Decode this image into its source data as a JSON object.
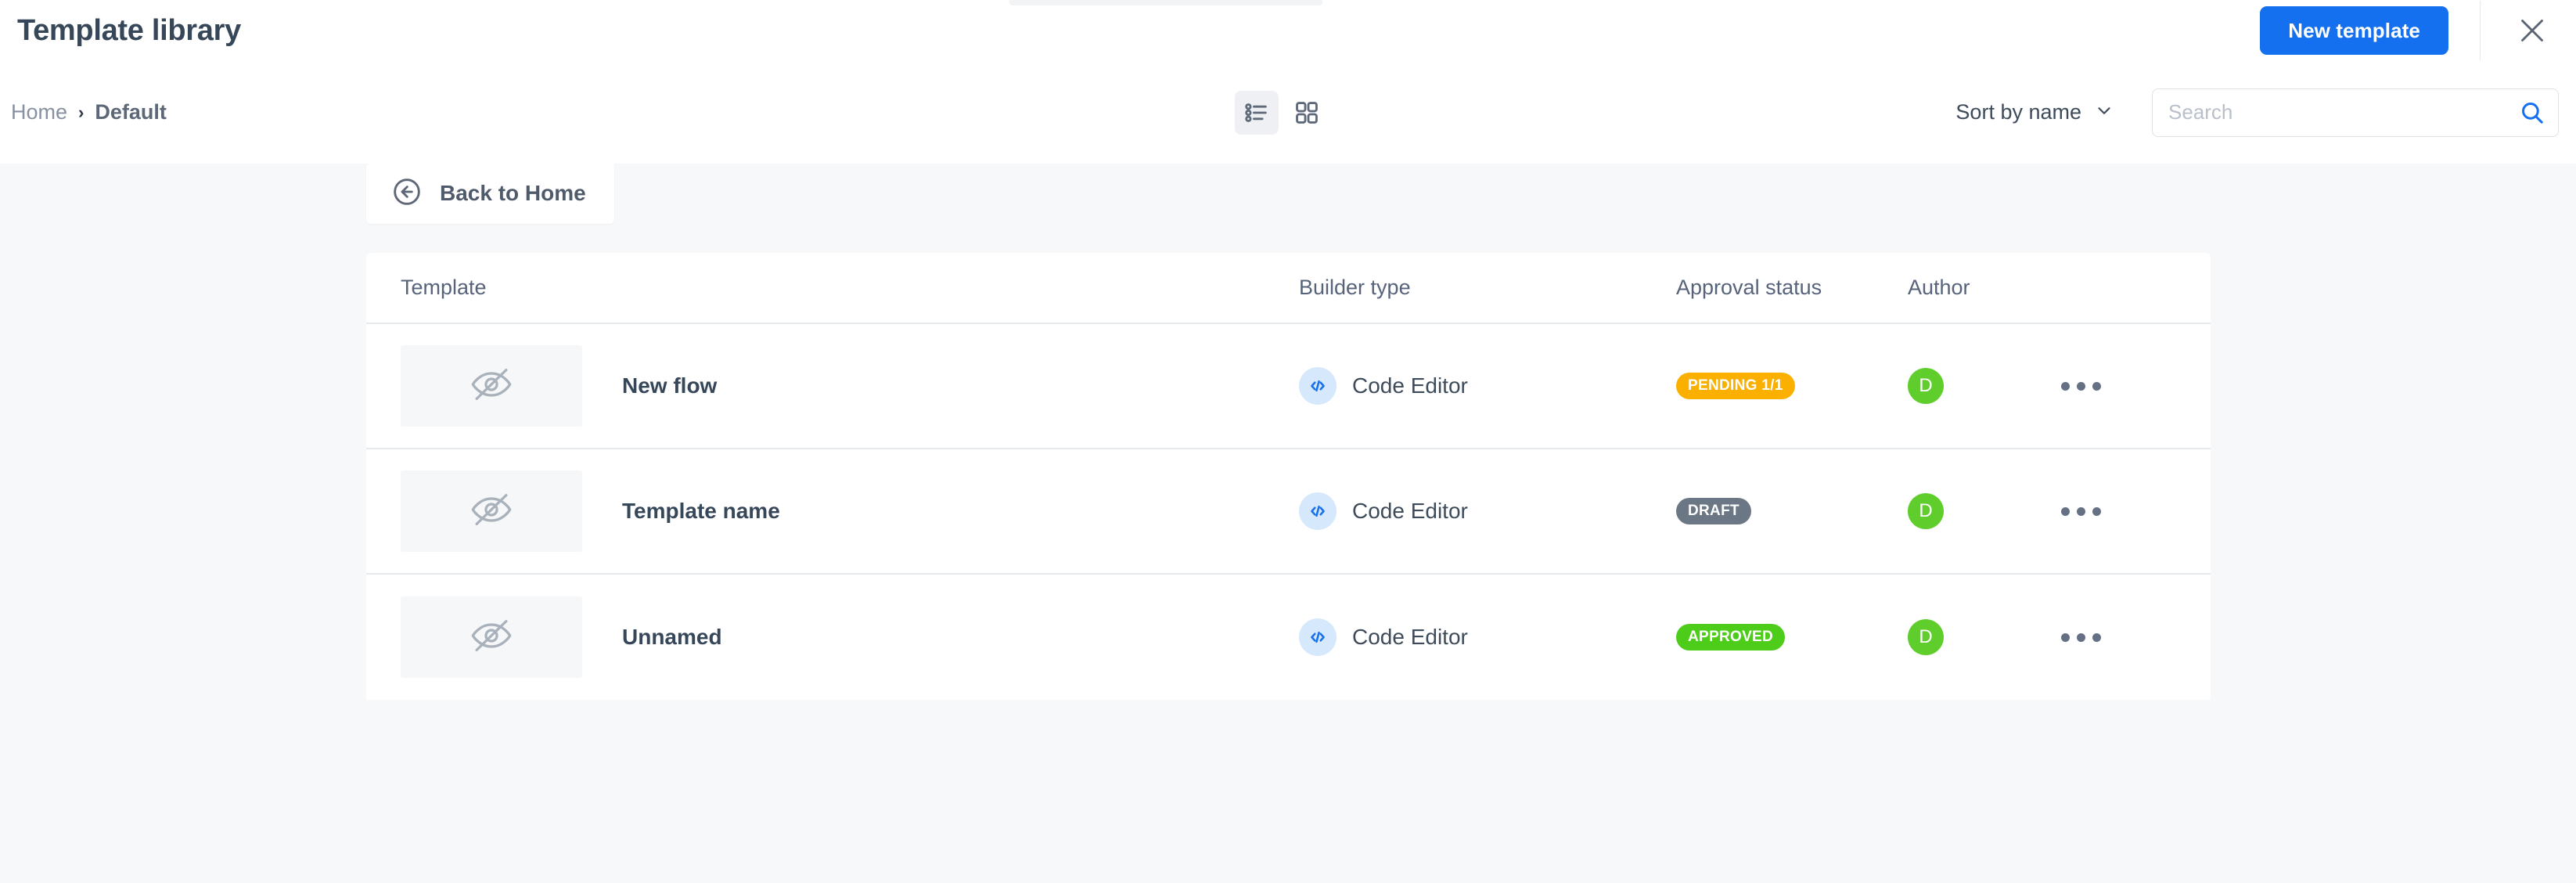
{
  "header": {
    "title": "Template library",
    "new_template_label": "New template",
    "close_icon": "close-icon"
  },
  "toolbar": {
    "breadcrumb": {
      "home": "Home",
      "separator": "›",
      "current": "Default"
    },
    "views": [
      {
        "name": "list-view",
        "icon": "list-view-icon",
        "active": true
      },
      {
        "name": "grid-view",
        "icon": "grid-view-icon",
        "active": false
      }
    ],
    "sort_label": "Sort by name",
    "sort_chevron_icon": "chevron-down-icon",
    "search": {
      "value": "",
      "placeholder": "Search",
      "icon": "search-icon"
    }
  },
  "content": {
    "back_button": {
      "label": "Back to Home",
      "icon": "arrow-circle-left-icon"
    },
    "table": {
      "columns": {
        "template": "Template",
        "builder": "Builder type",
        "status": "Approval status",
        "author": "Author"
      },
      "rows": [
        {
          "name": "New flow",
          "thumbnail_icon": "eye-off-icon",
          "builder_icon": "code-icon",
          "builder": "Code Editor",
          "status": "PENDING 1/1",
          "status_color": "#fbb000",
          "author_initial": "D",
          "author_color": "#5fcd2b",
          "actions_icon": "more-horizontal-icon"
        },
        {
          "name": "Template name",
          "thumbnail_icon": "eye-off-icon",
          "builder_icon": "code-icon",
          "builder": "Code Editor",
          "status": "DRAFT",
          "status_color": "#6b7785",
          "author_initial": "D",
          "author_color": "#5fcd2b",
          "actions_icon": "more-horizontal-icon"
        },
        {
          "name": "Unnamed",
          "thumbnail_icon": "eye-off-icon",
          "builder_icon": "code-icon",
          "builder": "Code Editor",
          "status": "APPROVED",
          "status_color": "#4dcd19",
          "author_initial": "D",
          "author_color": "#5fcd2b",
          "actions_icon": "more-horizontal-icon"
        }
      ]
    }
  },
  "colors": {
    "accent": "#1470ef",
    "page_bg": "#f7f8fa",
    "card_bg": "#ffffff",
    "text_dark": "#37475a",
    "text_muted": "#8791a0",
    "border": "#e7eaee"
  }
}
